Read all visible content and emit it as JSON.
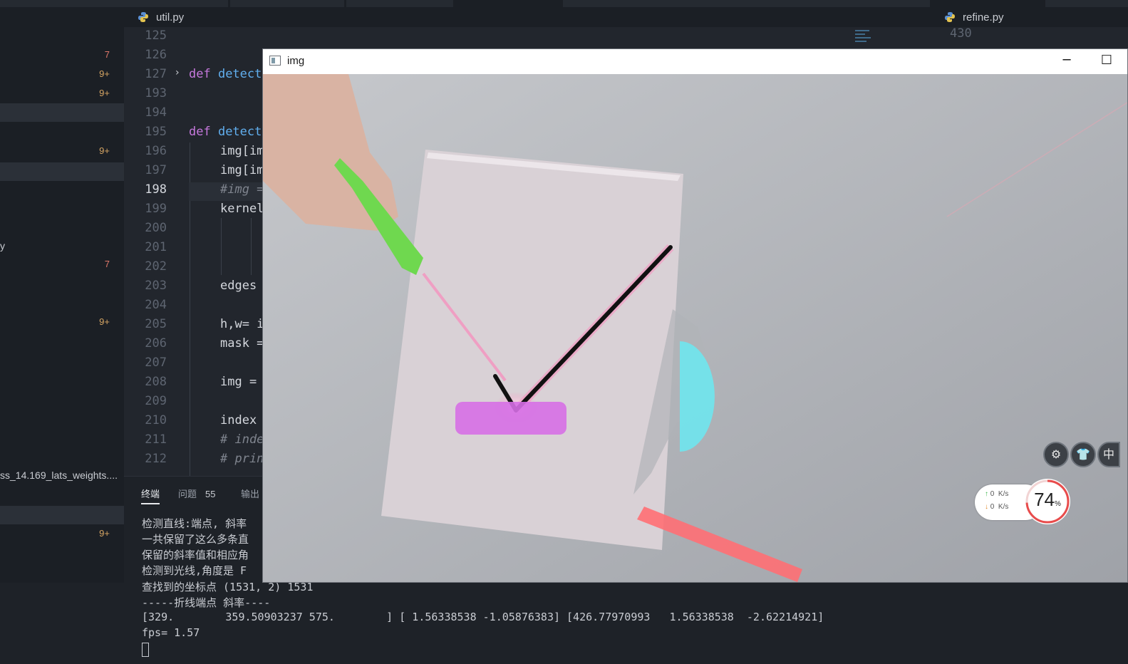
{
  "tabs": {
    "left_file": "util.py",
    "right_file": "refine.py"
  },
  "sidebar": {
    "rows": [
      {
        "count": "7",
        "tone": "error"
      },
      {
        "count": "9+",
        "tone": "warn"
      },
      {
        "count": "9+",
        "tone": "warn"
      },
      {
        "count": "9+",
        "tone": "warn"
      },
      {
        "text": "y"
      },
      {
        "count": "7",
        "tone": "error"
      },
      {
        "count": "9+",
        "tone": "warn"
      },
      {
        "text": "ss_14.169_lats_weights...."
      },
      {
        "count": "9+",
        "tone": "warn"
      }
    ]
  },
  "editor": {
    "line_numbers": [
      "125",
      "126",
      "127",
      "193",
      "194",
      "195",
      "196",
      "197",
      "198",
      "199",
      "200",
      "201",
      "202",
      "203",
      "204",
      "205",
      "206",
      "207",
      "208",
      "209",
      "210",
      "211",
      "212"
    ],
    "current_line": "198",
    "right_pane_line": "430",
    "code": {
      "l127_kw": "def",
      "l127_fn": " detect",
      "l195_kw": "def",
      "l195_fn": " detect",
      "l196": "img[im",
      "l197": "img[im",
      "l198": "#img =",
      "l199": "kernel",
      "l203": "edges",
      "l205": "h,w= i",
      "l206": "mask =",
      "l208": "img = ",
      "l210": "index",
      "l211": "# inde",
      "l212": "# prin"
    }
  },
  "panel": {
    "tabs": {
      "terminal": "终端",
      "problems": "问题",
      "problems_count": "55",
      "output": "输出"
    },
    "terminal_lines": [
      "检测直线:端点, 斜率",
      "一共保留了这么多条直",
      "保留的斜率值和相应角",
      "检测到光线,角度是 F",
      "查找到的坐标点 (1531, 2) 1531",
      "-----折线端点 斜率----",
      "[329.        359.50903237 575.        ] [ 1.56338538 -1.05876383] [426.77970993   1.56338538  -2.62214921]",
      "fps= 1.57"
    ]
  },
  "window": {
    "title": "img",
    "minimize": "─",
    "maximize": "☐"
  },
  "overlay": {
    "buttons": [
      {
        "icon": "gear-icon",
        "glyph": "⚙"
      },
      {
        "icon": "shirt-icon",
        "glyph": "👕"
      },
      {
        "icon": "chinese-input-icon",
        "glyph": "中"
      }
    ],
    "net_up": "0",
    "net_down": "0",
    "net_unit": "K/s",
    "percent": "74",
    "percent_sign": "%"
  },
  "colors": {
    "error": "#e0786a",
    "warn": "#d6a563",
    "laser": "#ff6fb0",
    "protractor": "#6fe6ee",
    "pointer": "#6fd84f",
    "holder": "#d66fe6",
    "ruler": "#ff6f74"
  }
}
